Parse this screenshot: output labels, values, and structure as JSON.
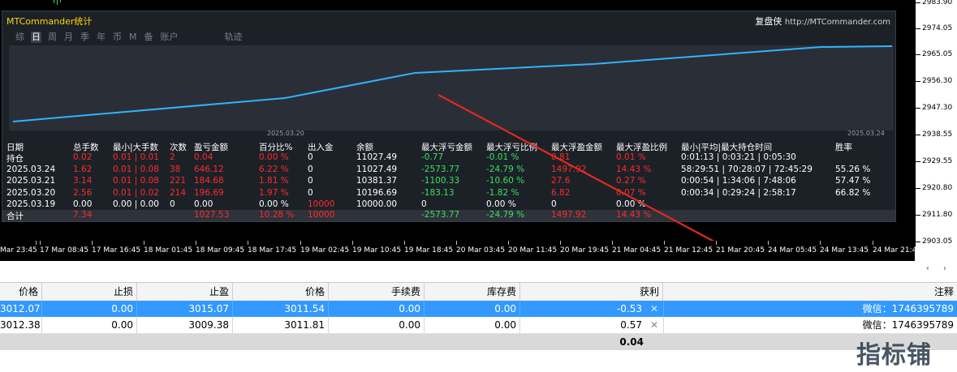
{
  "colors": {
    "accent_line": "#2fb4ff",
    "annotation_arrow": "#e02a20",
    "profit_red": "#ff2a2a",
    "loss_green": "#39e25a",
    "selection_blue": "#3399ff"
  },
  "price_axis": [
    "2983.90",
    "2974.05",
    "2965.05",
    "2956.30",
    "2947.30",
    "2938.55",
    "2929.55",
    "2920.80",
    "2911.80",
    "2903.05"
  ],
  "time_axis": [
    "Mar 23:45",
    "17 Mar 08:45",
    "17 Mar 16:45",
    "18 Mar 01:45",
    "18 Mar 09:45",
    "18 Mar 17:45",
    "19 Mar 02:45",
    "19 Mar 10:45",
    "19 Mar 18:45",
    "20 Mar 03:45",
    "20 Mar 11:45",
    "20 Mar 19:45",
    "21 Mar 04:45",
    "21 Mar 12:45",
    "21 Mar 20:45",
    "24 Mar 05:45",
    "24 Mar 13:45",
    "24 Mar 21:45"
  ],
  "panel": {
    "title": "MTCommander统计",
    "brand": "复盘侠",
    "url": "http://MTCommander.com",
    "tabs": [
      "综",
      "日",
      "周",
      "月",
      "季",
      "年",
      "币",
      "M",
      "备",
      "账户",
      "轨迹"
    ],
    "active_tab": "日",
    "plot_date_left": "2025.03.20",
    "plot_date_right": "2025.03.24",
    "equity_curve": [
      0.07,
      0.36,
      0.67,
      0.78,
      0.99,
      1.0
    ],
    "headers": [
      "日期",
      "总手数",
      "最小|大手数",
      "次数",
      "盈亏金额",
      "百分比%",
      "出入金",
      "余额",
      "最大浮亏金额",
      "最大浮亏比例",
      "最大浮盈金额",
      "最大浮盈比例",
      "最小|平均|最大持仓时间",
      "",
      "胜率"
    ],
    "rows": [
      [
        "持仓",
        "0.02",
        "0.01 | 0.01",
        "2",
        "0.04",
        "0.00 %",
        "0",
        "11027.49",
        "-0.77",
        "-0.01 %",
        "0.81",
        "0.01 %",
        "0:01:13 | 0:03:21 | 0:05:30",
        "",
        ""
      ],
      [
        "2025.03.24",
        "1.62",
        "0.01 | 0.08",
        "38",
        "646.12",
        "6.22 %",
        "0",
        "11027.49",
        "-2573.77",
        "-24.79 %",
        "1497.92",
        "14.43 %",
        "58:29:51 | 70:28:07 | 72:45:29",
        "",
        "55.26 %"
      ],
      [
        "2025.03.21",
        "3.14",
        "0.01 | 0.08",
        "221",
        "184.68",
        "1.81 %",
        "0",
        "10381.37",
        "-1100.33",
        "-10.60 %",
        "27.6",
        "0.27 %",
        "0:00:54 | 1:34:06 | 7:48:06",
        "",
        "57.47 %"
      ],
      [
        "2025.03.20",
        "2.56",
        "0.01 | 0.02",
        "214",
        "196.69",
        "1.97 %",
        "0",
        "10196.69",
        "-183.13",
        "-1.82 %",
        "6.82",
        "0.07 %",
        "0:00:34 | 0:29:24 | 2:58:17",
        "",
        "66.82 %"
      ],
      [
        "2025.03.19",
        "0.00",
        "0.00 | 0.00",
        "0",
        "0.00",
        "0.00 %",
        "10000",
        "10000.00",
        "0",
        "0.00 %",
        "0",
        "0.00 %",
        "",
        "",
        ""
      ]
    ],
    "total": [
      "合计",
      "7.34",
      "",
      "",
      "1027.53",
      "10.28 %",
      "10000",
      "",
      "-2573.77",
      "-24.79 %",
      "1497.92",
      "14.43 %",
      "",
      "",
      ""
    ]
  },
  "trade_table": {
    "nav": "‹ ›",
    "headers": [
      "价格",
      "止损",
      "止盈",
      "价格",
      "手续费",
      "库存费",
      "获利",
      "注释"
    ],
    "rows": [
      {
        "price": "3012.07",
        "sl": "0.00",
        "tp": "3015.07",
        "cur_price": "3011.54",
        "commission": "0.00",
        "swap": "0.00",
        "profit": "-0.53",
        "close": "✕",
        "comment": "微信：1746395789",
        "selected": true
      },
      {
        "price": "3012.38",
        "sl": "0.00",
        "tp": "3009.38",
        "cur_price": "3011.81",
        "commission": "0.00",
        "swap": "0.00",
        "profit": "0.57",
        "close": "✕",
        "comment": "微信：1746395789",
        "selected": false
      }
    ],
    "sum_profit": "0.04"
  },
  "watermark": "指标铺"
}
